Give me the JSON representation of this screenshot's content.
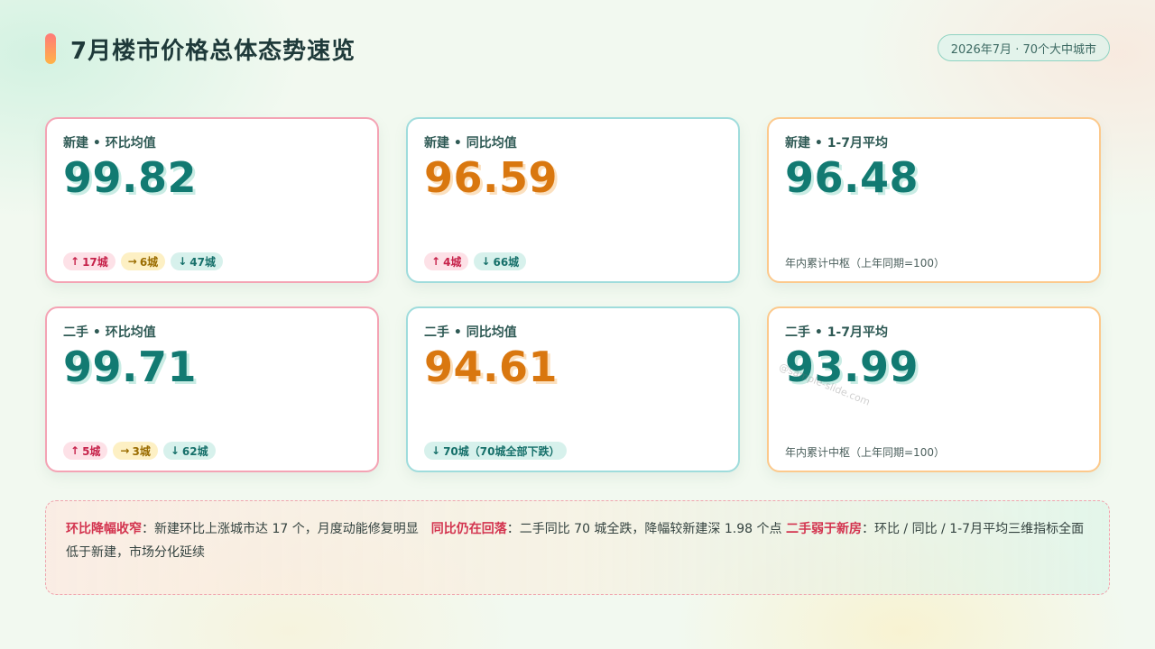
{
  "header": {
    "title": "7月楼市价格总体态势速览",
    "date_badge": "2026年7月 · 70个大中城市"
  },
  "cards": [
    {
      "label": "新建 • 环比均值",
      "value": "99.82",
      "tags": [
        {
          "arrow": "↑",
          "text": "17城",
          "kind": "up"
        },
        {
          "arrow": "→",
          "text": "6城",
          "kind": "flat"
        },
        {
          "arrow": "↓",
          "text": "47城",
          "kind": "down"
        }
      ]
    },
    {
      "label": "新建 • 同比均值",
      "value": "96.59",
      "tags": [
        {
          "arrow": "↑",
          "text": "4城",
          "kind": "up"
        },
        {
          "arrow": "↓",
          "text": "66城",
          "kind": "down"
        }
      ]
    },
    {
      "label": "新建 • 1-7月平均",
      "value": "96.48",
      "note": "年内累计中枢（上年同期=100）"
    },
    {
      "label": "二手 • 环比均值",
      "value": "99.71",
      "tags": [
        {
          "arrow": "↑",
          "text": "5城",
          "kind": "up"
        },
        {
          "arrow": "→",
          "text": "3城",
          "kind": "flat"
        },
        {
          "arrow": "↓",
          "text": "62城",
          "kind": "down"
        }
      ]
    },
    {
      "label": "二手 • 同比均值",
      "value": "94.61",
      "tags": [
        {
          "arrow": "↓",
          "text": "70城（70城全部下跌）",
          "kind": "down"
        }
      ]
    },
    {
      "label": "二手 • 1-7月平均",
      "value": "93.99",
      "note": "年内累计中枢（上年同期=100）"
    }
  ],
  "summary": {
    "h1": "环比降幅收窄",
    "t1": "：新建环比上涨城市达 17 个，月度动能修复明显　",
    "h2": "同比仍在回落",
    "t2": "：二手同比 70 城全跌，降幅较新建深 1.98 个点 ",
    "h3": "二手弱于新房",
    "t3": "：环比 / 同比 / 1-7月平均三维指标全面低于新建，市场分化延续"
  },
  "watermark": "@sample-slide.com",
  "colors": {
    "teal": "#127a72",
    "orange": "#d9770f",
    "pink_border": "#f4a3b4",
    "cyan_border": "#9fdcdc",
    "orange_border": "#fcc98c",
    "highlight_red": "#d3344f"
  }
}
